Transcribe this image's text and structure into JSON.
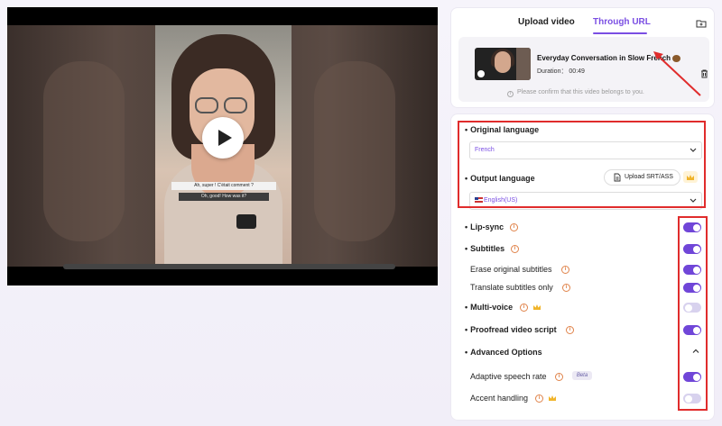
{
  "player": {
    "subtitle_line1": "Ah, super ! C'était comment ?",
    "subtitle_line2": "Oh, good! How was it?"
  },
  "upload": {
    "tab_upload": "Upload video",
    "tab_url": "Through URL",
    "video_title": "Everyday Conversation in Slow French",
    "video_duration": "Duration： 00:49",
    "confirm_note": "Please confirm that this video belongs to you.",
    "active_tab": "Through URL"
  },
  "languages": {
    "original_label": "Original language",
    "original_value": "French",
    "output_label": "Output language",
    "output_value": "English(US)",
    "upload_srt_label": "Upload SRT/ASS"
  },
  "options": {
    "lip_sync": {
      "label": "Lip-sync",
      "enabled": true
    },
    "subtitles": {
      "label": "Subtitles",
      "enabled": true
    },
    "erase_original": {
      "label": "Erase original subtitles",
      "enabled": true
    },
    "translate_only": {
      "label": "Translate subtitles only",
      "enabled": true
    },
    "multi_voice": {
      "label": "Multi-voice",
      "enabled": false
    },
    "proofread": {
      "label": "Proofread video script",
      "enabled": true
    },
    "advanced_label": "Advanced Options",
    "adaptive_speech": {
      "label": "Adaptive speech rate",
      "enabled": true,
      "badge": "Beta"
    },
    "accent_handling": {
      "label": "Accent handling",
      "enabled": false
    }
  },
  "bullet": "•",
  "colors": {
    "accent": "#7a4ee3",
    "toggle_on": "#7046d8",
    "toggle_off": "#d8d2ee",
    "highlight_box": "#e02c2c"
  }
}
